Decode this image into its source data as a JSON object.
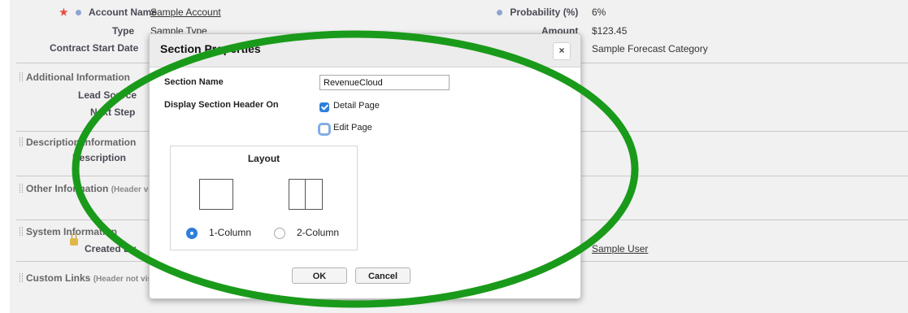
{
  "record": {
    "account_name_label": "Account Name",
    "account_name_value": "Sample Account",
    "type_label": "Type",
    "type_value": "Sample Type",
    "contract_start_label": "Contract Start Date",
    "probability_label": "Probability (%)",
    "probability_value": "6%",
    "amount_label": "Amount",
    "amount_value": "$123.45",
    "forecast_category_value": "Sample Forecast Category"
  },
  "sections": {
    "additional_information": "Additional Information",
    "lead_source_label": "Lead Source",
    "next_step_label": "Next Step",
    "description_information": "Description Information",
    "description_label": "Description",
    "other_information": "Other Information",
    "other_information_note": "(Header visible on edit only)",
    "system_information": "System Information",
    "created_by_label": "Created By",
    "last_modified_value": "Sample User",
    "custom_links": "Custom Links",
    "custom_links_note": "(Header not visible)"
  },
  "dialog": {
    "title": "Section Properties",
    "close_icon": "×",
    "section_name_label": "Section Name",
    "section_name_value": "RevenueCloud",
    "display_header_label": "Display Section Header On",
    "detail_page_label": "Detail Page",
    "detail_page_checked": true,
    "edit_page_label": "Edit Page",
    "edit_page_checked": false,
    "layout_title": "Layout",
    "one_column_label": "1-Column",
    "two_column_label": "2-Column",
    "selected_layout": "1-Column",
    "ok_label": "OK",
    "cancel_label": "Cancel"
  },
  "annotation": {
    "shape": "ellipse",
    "color": "#1a9a1a"
  }
}
